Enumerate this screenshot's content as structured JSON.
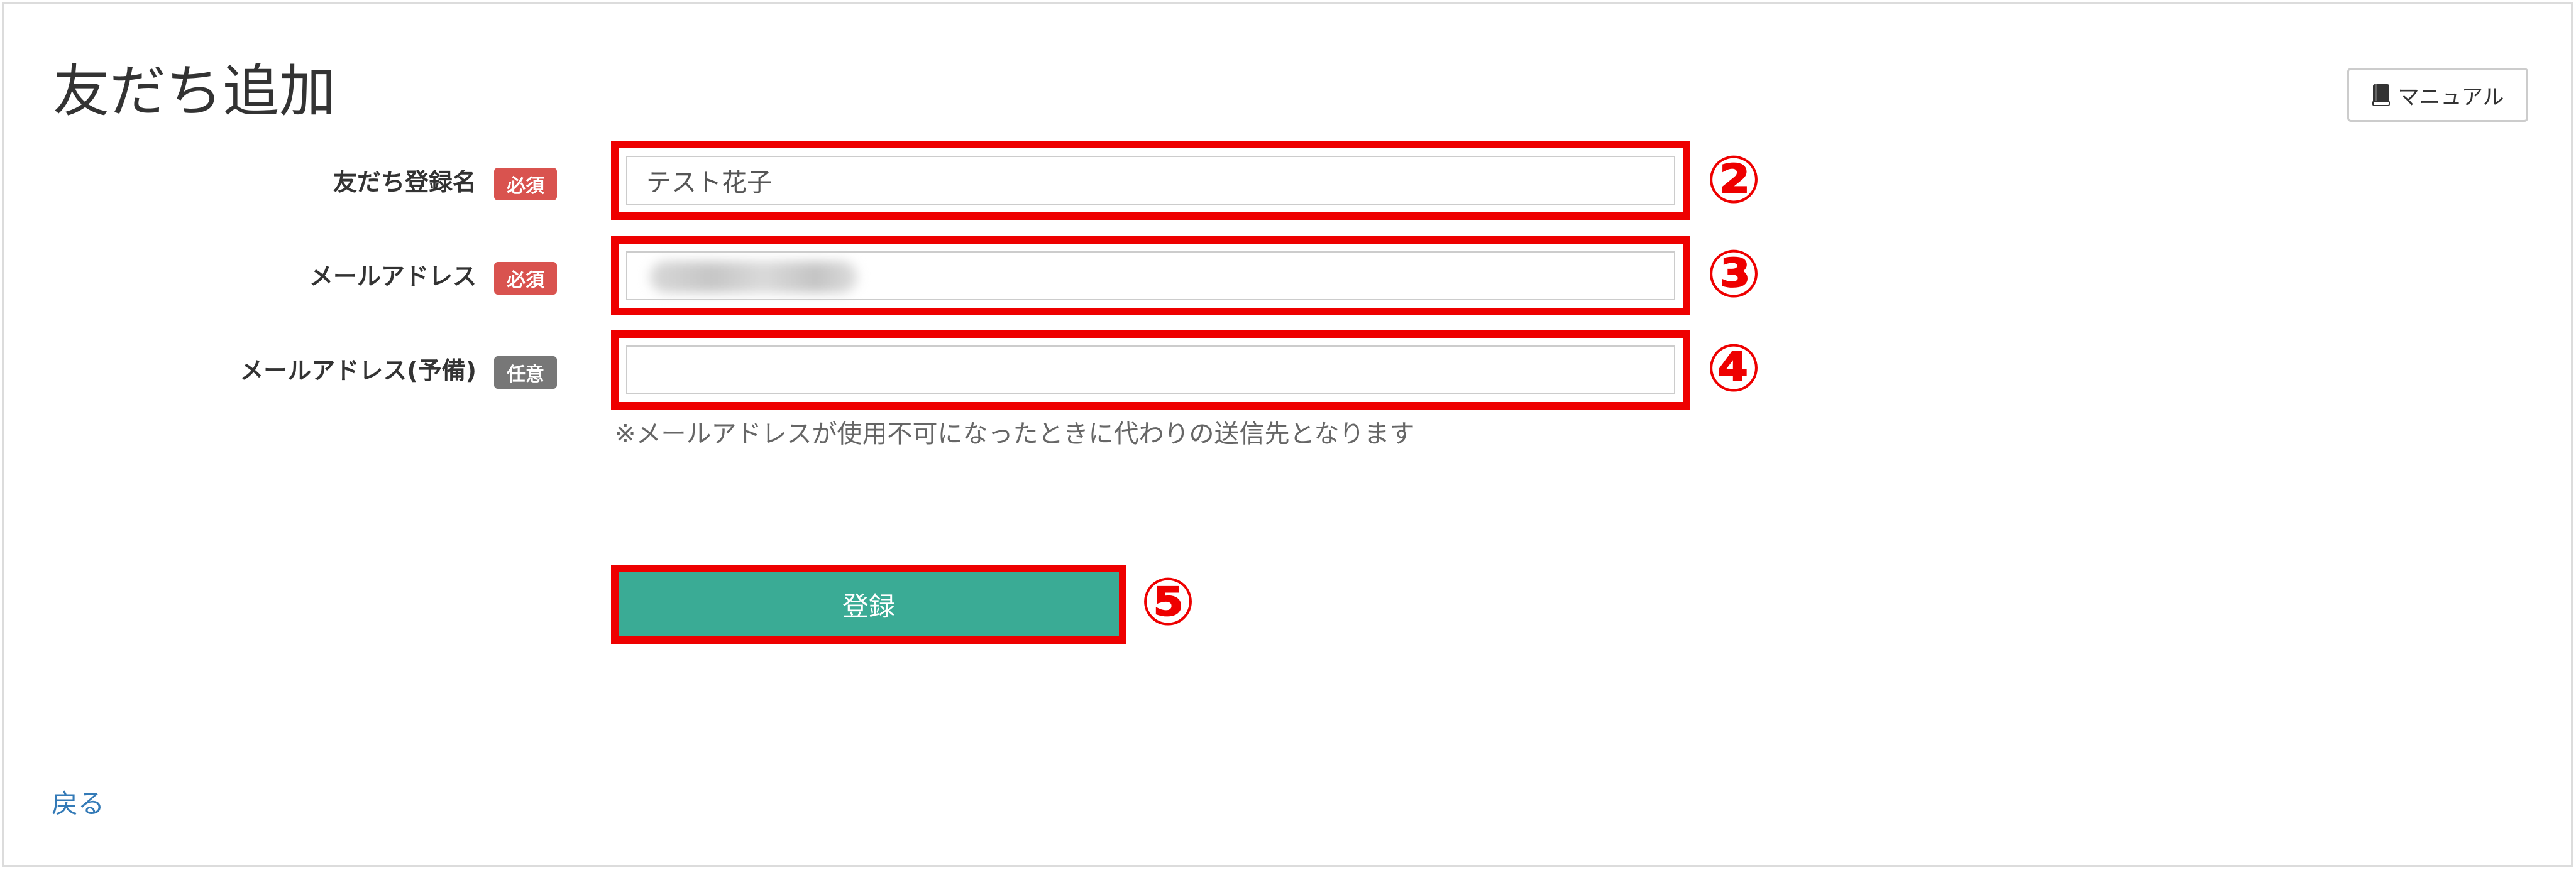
{
  "page": {
    "title": "友だち追加"
  },
  "header": {
    "manual_label": "マニュアル"
  },
  "form": {
    "fields": [
      {
        "label": "友だち登録名",
        "badge": "必須",
        "value": "テスト花子",
        "marker": "②"
      },
      {
        "label": "メールアドレス",
        "badge": "必須",
        "value": "",
        "marker": "③"
      },
      {
        "label": "メールアドレス(予備)",
        "badge": "任意",
        "value": "",
        "marker": "④"
      }
    ],
    "help_text": "※メールアドレスが使用不可になったときに代わりの送信先となります",
    "submit_label": "登録",
    "submit_marker": "⑤"
  },
  "footer": {
    "back_label": "戻る"
  },
  "colors": {
    "required_badge": "#d9534f",
    "optional_badge": "#777777",
    "submit_button": "#3aab95",
    "highlight": "#ee0000",
    "link": "#337ab7"
  },
  "icons": {
    "manual": "book-icon"
  }
}
